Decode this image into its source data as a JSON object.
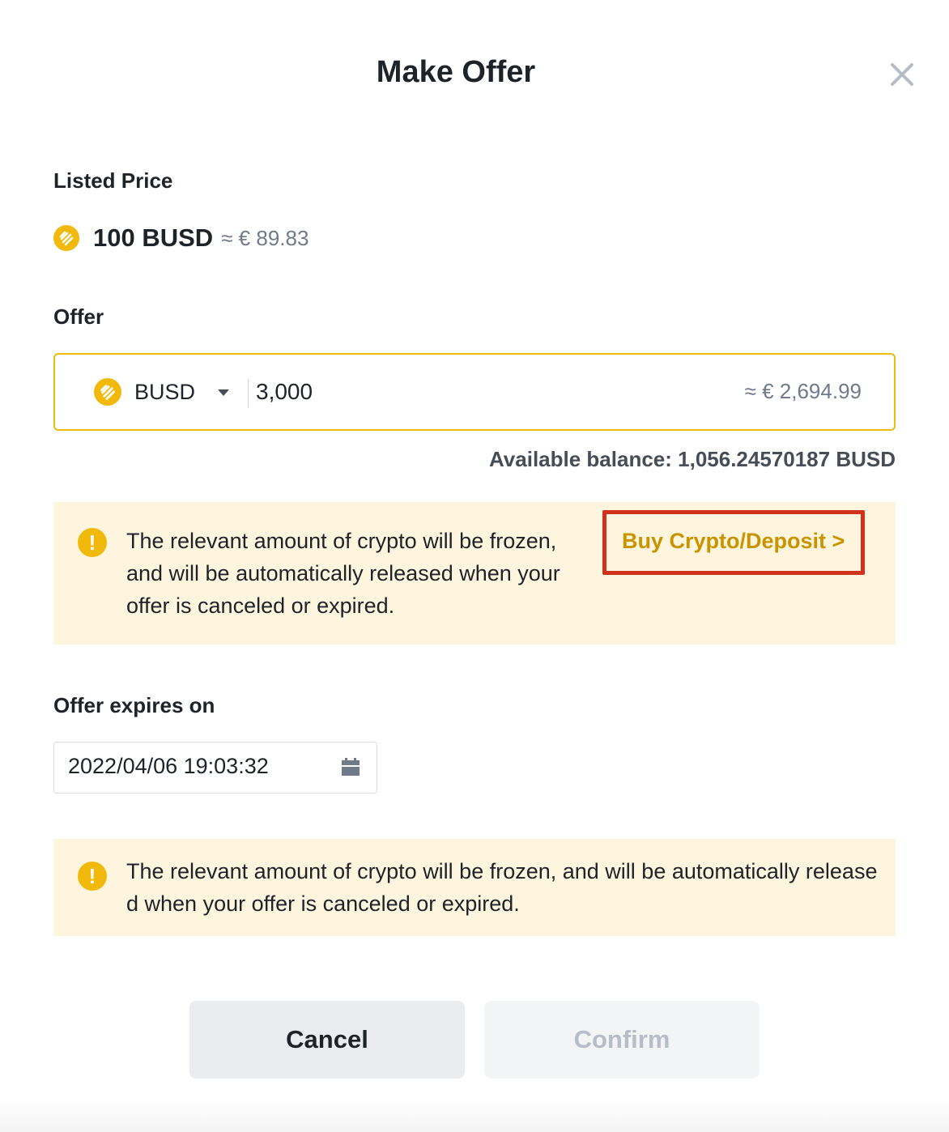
{
  "dialog": {
    "title": "Make Offer"
  },
  "listed_price": {
    "label": "Listed Price",
    "amount": "100 BUSD",
    "approx": "≈ € 89.83"
  },
  "offer": {
    "label": "Offer",
    "currency": "BUSD",
    "amount": "3,000",
    "approx": "≈ € 2,694.99"
  },
  "balance": {
    "text": "Available balance: 1,056.24570187 BUSD"
  },
  "notice_top": {
    "text": "The relevant amount of crypto will be frozen, and will be automatically released when your offer is canceled or expired.",
    "link_label": "Buy Crypto/Deposit >"
  },
  "expiry": {
    "label": "Offer expires on",
    "value": "2022/04/06 19:03:32"
  },
  "notice_bottom": {
    "text": "The relevant amount of crypto will be frozen, and will be automatically released when your offer is canceled or expired."
  },
  "actions": {
    "cancel_label": "Cancel",
    "confirm_label": "Confirm"
  },
  "icons": {
    "coin": "busd-coin-icon",
    "close": "close-icon",
    "warning": "exclamation-icon",
    "calendar": "calendar-icon",
    "dropdown": "caret-down-icon"
  },
  "colors": {
    "accent": "#f0b90b",
    "link": "#c99400",
    "notice_bg": "#fdf5dd",
    "highlight_border": "#d0321d"
  }
}
